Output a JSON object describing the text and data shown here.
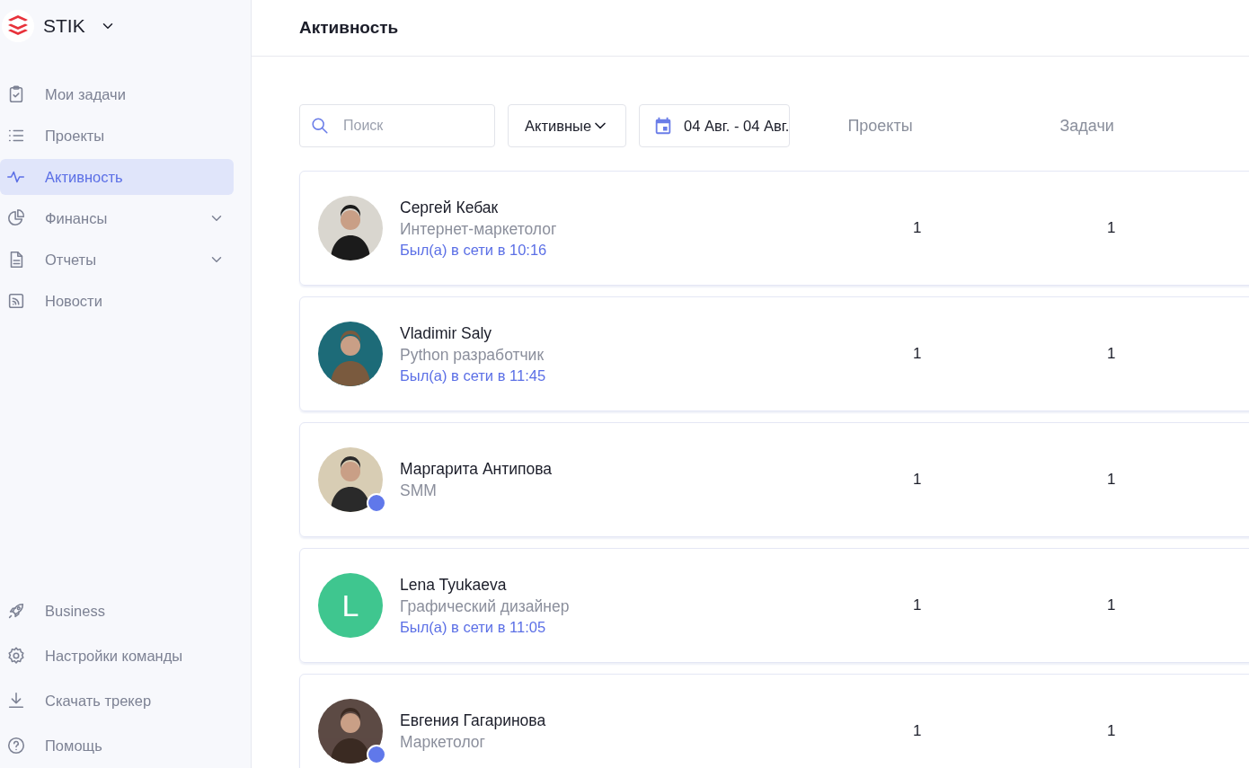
{
  "sidebar": {
    "workspace": "STIK",
    "items": [
      {
        "label": "Мои задачи",
        "selected": false,
        "expandable": false
      },
      {
        "label": "Проекты",
        "selected": false,
        "expandable": false
      },
      {
        "label": "Активность",
        "selected": true,
        "expandable": false
      },
      {
        "label": "Финансы",
        "selected": false,
        "expandable": true
      },
      {
        "label": "Отчеты",
        "selected": false,
        "expandable": true
      },
      {
        "label": "Новости",
        "selected": false,
        "expandable": false
      }
    ],
    "bottom_items": [
      {
        "label": "Business"
      },
      {
        "label": "Настройки команды"
      },
      {
        "label": "Скачать трекер"
      },
      {
        "label": "Помощь"
      }
    ]
  },
  "header": {
    "title": "Активность"
  },
  "filters": {
    "search": {
      "placeholder": "Поиск"
    },
    "status": {
      "value": "Активные"
    },
    "date_range": {
      "value": "04 Авг. - 04 Авг."
    }
  },
  "columns": [
    "Проекты",
    "Задачи"
  ],
  "members": [
    {
      "name": "Сергей Кебак",
      "role": "Интернет-маркетолог",
      "last_seen": "Был(а) в сети в 10:16",
      "online": false,
      "projects": "1",
      "tasks": "1"
    },
    {
      "name": "Vladimir Saly",
      "role": "Python разработчик",
      "last_seen": "Был(а) в сети в 11:45",
      "online": false,
      "projects": "1",
      "tasks": "1"
    },
    {
      "name": "Маргарита Антипова",
      "role": "SMM",
      "online": true,
      "projects": "1",
      "tasks": "1"
    },
    {
      "name": "Lena Tyukaeva",
      "role": "Графический дизайнер",
      "last_seen": "Был(а) в сети в 11:05",
      "avatar": {
        "kind": "initial",
        "text": "L",
        "color": "#3fc68f"
      },
      "online": false,
      "projects": "1",
      "tasks": "1"
    },
    {
      "name": "Евгения Гагаринова",
      "role": "Маркетолог",
      "online": true,
      "projects": "1",
      "tasks": "1"
    }
  ]
}
